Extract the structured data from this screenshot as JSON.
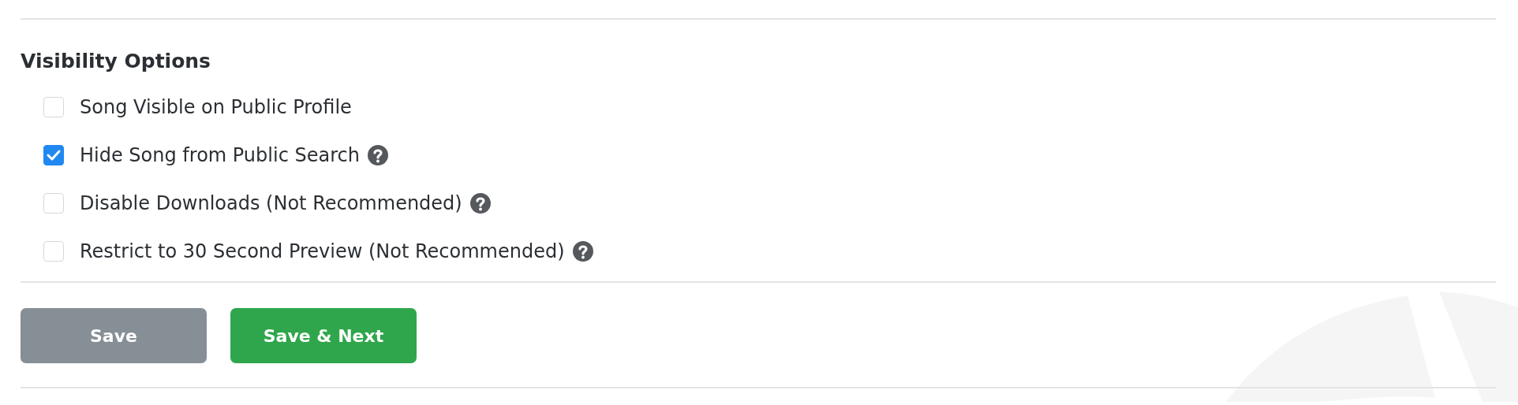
{
  "section": {
    "title": "Visibility Options"
  },
  "options": [
    {
      "label": "Song Visible on Public Profile",
      "checked": false,
      "help": false
    },
    {
      "label": "Hide Song from Public Search",
      "checked": true,
      "help": true
    },
    {
      "label": "Disable Downloads (Not Recommended)",
      "checked": false,
      "help": true
    },
    {
      "label": "Restrict to 30 Second Preview (Not Recommended)",
      "checked": false,
      "help": true
    }
  ],
  "buttons": [
    {
      "label": "Save",
      "kind": "secondary"
    },
    {
      "label": "Save & Next",
      "kind": "primary"
    }
  ]
}
